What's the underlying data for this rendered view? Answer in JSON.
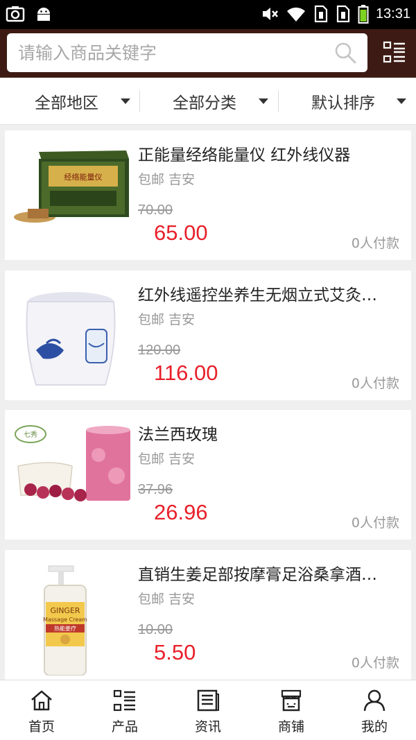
{
  "status_bar": {
    "time": "13:31"
  },
  "search": {
    "placeholder": "请输入商品关键字"
  },
  "filters": [
    {
      "label": "全部地区"
    },
    {
      "label": "全部分类"
    },
    {
      "label": "默认排序"
    }
  ],
  "products": [
    {
      "title": "正能量经络能量仪 红外线仪器",
      "shipping": "包邮",
      "location": "吉安",
      "original_price": "70.00",
      "price": "65.00",
      "sales": "0人付款"
    },
    {
      "title": "红外线遥控坐养生无烟立式艾灸…",
      "shipping": "包邮",
      "location": "吉安",
      "original_price": "120.00",
      "price": "116.00",
      "sales": "0人付款"
    },
    {
      "title": "法兰西玫瑰",
      "shipping": "包邮",
      "location": "吉安",
      "original_price": "37.96",
      "price": "26.96",
      "sales": "0人付款"
    },
    {
      "title": "直销生姜足部按摩膏足浴桑拿酒…",
      "shipping": "包邮",
      "location": "吉安",
      "original_price": "10.00",
      "price": "5.50",
      "sales": "0人付款"
    }
  ],
  "product_images": {
    "p1_box_text": "经络能量仪",
    "p3_brand": "七秀",
    "p4_brand": "GINGER",
    "p4_subtitle": "Massage Cream",
    "p4_cn": "热能姜疗"
  },
  "bottom_nav": [
    {
      "label": "首页",
      "icon": "home-icon"
    },
    {
      "label": "产品",
      "icon": "product-list-icon"
    },
    {
      "label": "资讯",
      "icon": "news-icon"
    },
    {
      "label": "商铺",
      "icon": "store-icon"
    },
    {
      "label": "我的",
      "icon": "user-icon"
    }
  ],
  "colors": {
    "header_bg": "#3d1b14",
    "price": "#e8202a",
    "accent_bg": "#efefef"
  }
}
